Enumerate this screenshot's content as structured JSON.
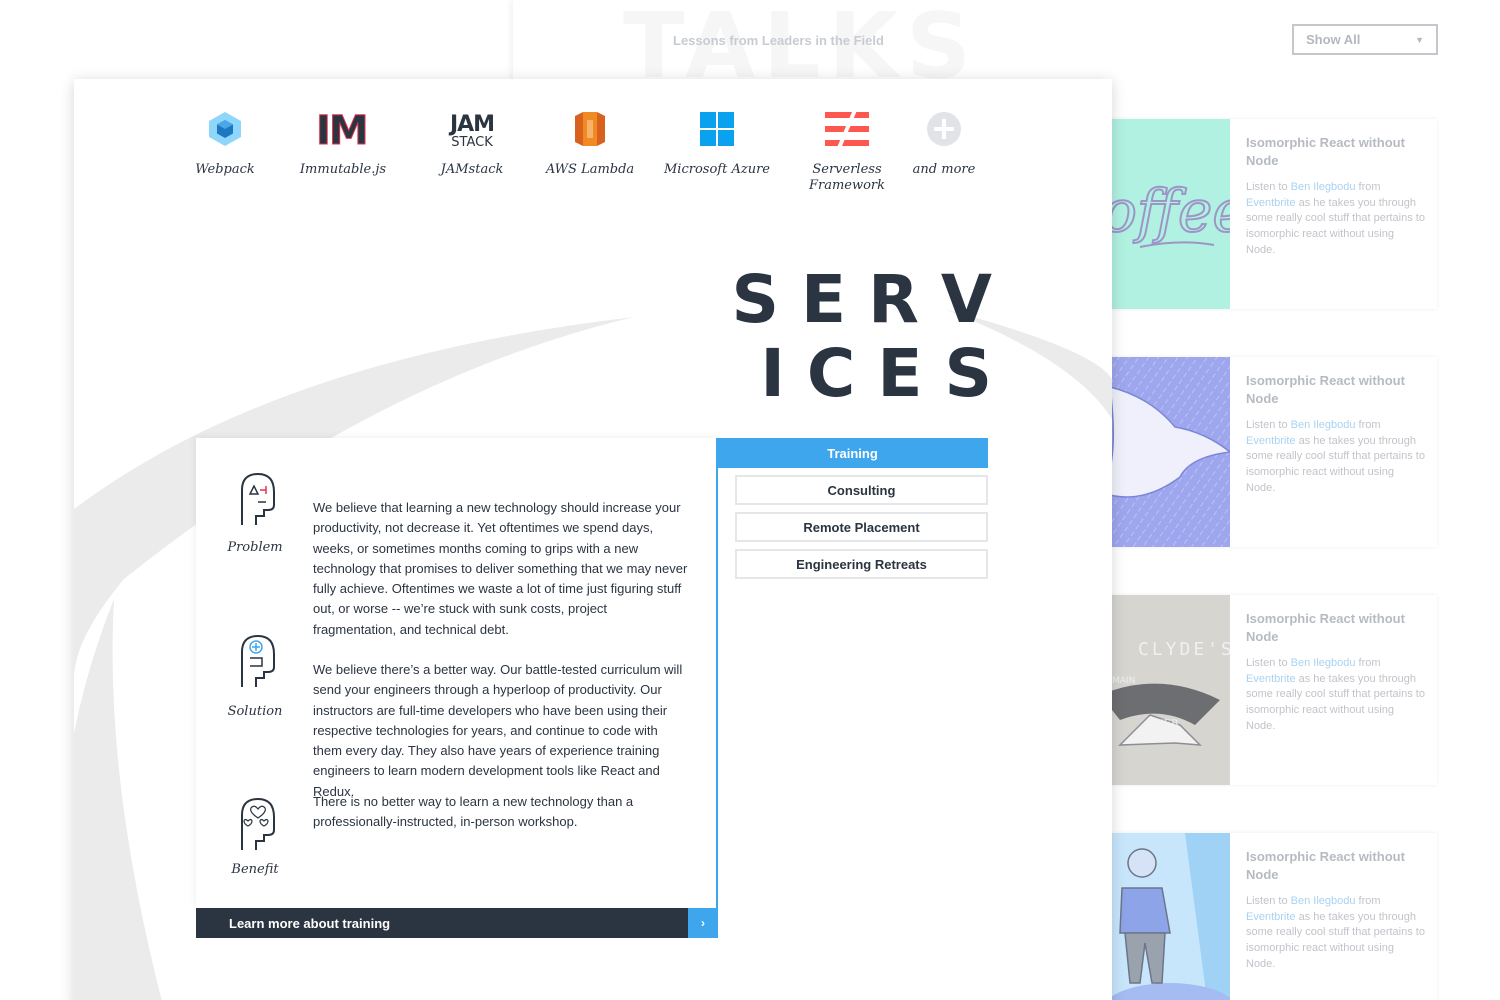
{
  "background_page": {
    "watermark": "TALKS",
    "subtitle": "Lessons from Leaders in the Field",
    "filter": {
      "selected": "Show All"
    },
    "talks": [
      {
        "title": "Isomorphic React without Node",
        "desc_pre": "Listen to ",
        "speaker": "Ben Ilegbodu",
        "desc_mid": " from ",
        "company": "Eventbrite",
        "desc_post": " as he takes you through some really cool stuff that pertains to isomorphic react without using Node.",
        "thumb_text": "offee"
      },
      {
        "title": "Isomorphic React without Node",
        "desc_pre": "Listen to ",
        "speaker": "Ben Ilegbodu",
        "desc_mid": " from ",
        "company": "Eventbrite",
        "desc_post": " as he takes you through some really cool stuff that pertains to isomorphic react without using Node."
      },
      {
        "title": "Isomorphic React without Node",
        "desc_pre": "Listen to ",
        "speaker": "Ben Ilegbodu",
        "desc_mid": " from ",
        "company": "Eventbrite",
        "desc_post": " as he takes you through some really cool stuff that pertains to isomorphic react without using Node.",
        "thumb_text": "CLYDE'S",
        "thumb_small_1": "MAIN",
        "thumb_small_2": "NEB"
      },
      {
        "title": "Isomorphic React without Node",
        "desc_pre": "Listen to ",
        "speaker": "Ben Ilegbodu",
        "desc_mid": " from ",
        "company": "Eventbrite",
        "desc_post": " as he takes you through some really cool stuff that pertains to isomorphic react without using Node."
      }
    ]
  },
  "technologies": [
    {
      "name": "Webpack",
      "icon": "webpack-cube-icon"
    },
    {
      "name": "Immutable.js",
      "icon": "immutable-im-icon",
      "logo_text": "IM"
    },
    {
      "name": "JAMstack",
      "icon": "jamstack-icon",
      "logo_text_1": "JAM",
      "logo_text_2": "STACK"
    },
    {
      "name": "AWS Lambda",
      "icon": "aws-lambda-icon"
    },
    {
      "name": "Microsoft Azure",
      "icon": "windows-icon"
    },
    {
      "name": "Serverless Framework",
      "icon": "serverless-icon"
    },
    {
      "name": "and more",
      "icon": "plus-circle-icon"
    }
  ],
  "services": {
    "title_line_1": "SERV",
    "title_line_2": "ICES",
    "pillars": [
      {
        "label": "Problem",
        "icon": "head-problem-icon",
        "text": "We believe that learning a new technology should increase your productivity, not decrease it. Yet oftentimes we spend days, weeks, or sometimes months coming to grips with a new technology that promises to deliver something that we may never fully achieve. Oftentimes we waste a lot of time just figuring stuff out, or worse -- we’re stuck with sunk costs, project fragmentation, and technical debt."
      },
      {
        "label": "Solution",
        "icon": "head-solution-icon",
        "text": "We believe there’s a better way. Our battle-tested curriculum will send your engineers through a hyperloop of productivity. Our instructors are full-time developers who have been using their respective technologies for years, and continue to code with them every day. They also have years of experience training engineers to learn modern development tools like React and Redux."
      },
      {
        "label": "Benefit",
        "icon": "head-benefit-icon",
        "text": "There is no better way to learn a new technology than a professionally-instructed, in-person workshop."
      }
    ],
    "cta_label": "Learn more about training",
    "cta_arrow": "›",
    "tabs": [
      "Training",
      "Consulting",
      "Remote Placement",
      "Engineering Retreats"
    ],
    "active_tab": "Training"
  },
  "colors": {
    "accent_blue": "#3ea6ec",
    "dark_navy": "#2b3441",
    "immutable_red": "#e2334d",
    "aws_orange": "#f08a24",
    "azure_blue": "#0aa1ee",
    "serverless_red": "#fd5750"
  }
}
